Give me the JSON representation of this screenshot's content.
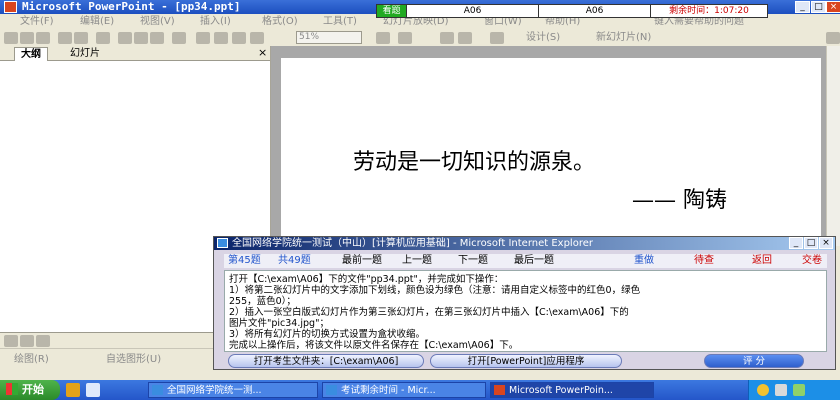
{
  "titlebar": {
    "title": "Microsoft PowerPoint - [pp34.ppt]",
    "controls": [
      "_",
      "□",
      "×"
    ]
  },
  "banner": {
    "view_label": "看题",
    "field1": "A06",
    "field2": "A06",
    "timer_label": "剩余时间：1:07:20",
    "colors": {
      "view_bg": "#22aa22",
      "timer_text": "#cc0000"
    }
  },
  "menu": {
    "items": [
      "文件(F)",
      "编辑(E)",
      "视图(V)",
      "插入(I)",
      "格式(O)",
      "工具(T)",
      "幻灯片放映(D)",
      "窗口(W)",
      "帮助(H)"
    ],
    "help_search": "键入需要帮助的问题"
  },
  "toolbar": {
    "zoom": "51%",
    "design_label": "设计(S)",
    "new_slide_label": "新幻灯片(N)"
  },
  "outline": {
    "tabs": [
      "大纲",
      "幻灯片"
    ],
    "close_glyph": "×"
  },
  "slide": {
    "line1": "劳动是一切知识的源泉。",
    "line2": "—— 陶铸"
  },
  "drawbar": {
    "draw_label": "绘图(R)",
    "autoshape_label": "自选图形(U)"
  },
  "dialog": {
    "title": "全国网络学院统一测试（中山）[计算机应用基础] - Microsoft Internet Explorer",
    "nav": {
      "question_no": "第45题",
      "total": "共49题",
      "first": "最前一题",
      "prev": "上一题",
      "next": "下一题",
      "last": "最后一题",
      "redo": "重做",
      "review": "待查",
      "back": "返回",
      "submit": "交卷"
    },
    "body": [
      "打开【C:\\exam\\A06】下的文件\"pp34.ppt\"，并完成如下操作：",
      "  1）将第二张幻灯片中的文字添加下划线，颜色设为绿色（注意：请用自定义标签中的红色0，绿色",
      "255，蓝色0）；",
      "  2）插入一张空白版式幻灯片作为第三张幻灯片，在第三张幻灯片中插入【C:\\exam\\A06】下的",
      "图片文件\"pic34.jpg\"；",
      "  3）将所有幻灯片的切换方式设置为盒状收缩。",
      "完成以上操作后，将该文件以原文件名保存在【C:\\exam\\A06】下。"
    ],
    "buttons": {
      "open_folder": "打开考生文件夹：[C:\\exam\\A06]",
      "open_app": "打开[PowerPoint]应用程序",
      "score": "评  分"
    }
  },
  "taskbar": {
    "start": "开始",
    "tasks": [
      "全国网络学院统一测...",
      "考试剩余时间 - Micr...",
      "Microsoft PowerPoin..."
    ]
  }
}
